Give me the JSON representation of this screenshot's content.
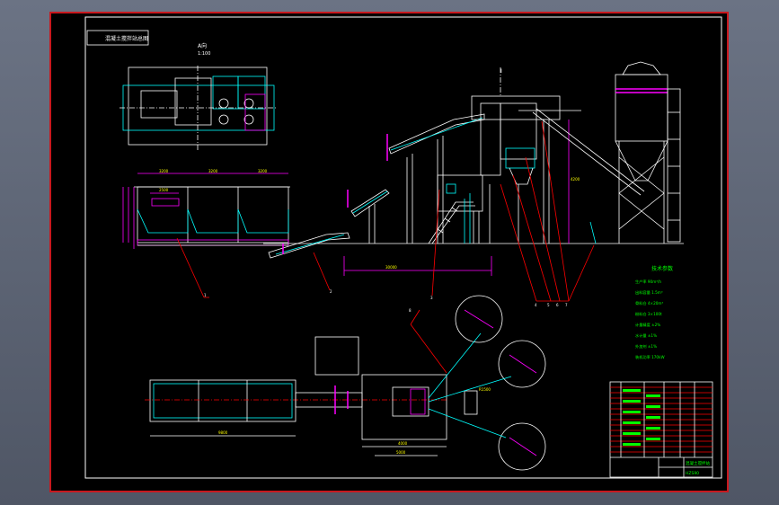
{
  "drawing": {
    "title_box_text": "混凝土搅拌站总图",
    "section_mark": "A向",
    "section_scale": "1:100",
    "top_mark": "I",
    "notes_title": "技术参数",
    "notes": [
      "生产率   90m³/h",
      "出料容量   1.5m³",
      "骨料仓   4×20m³",
      "粉料仓   3×100t",
      "计量精度  ±2%",
      "水计量   ±1%",
      "外加剂    ±1%",
      "装机功率   170kW"
    ],
    "dims": {
      "left_total": "5800",
      "left_parts": [
        "3200",
        "3200",
        "3200"
      ],
      "left_sub": "2500",
      "conveyor_span": "30000",
      "plant_height": "4200",
      "lower_dim_1": "9800",
      "lower_dim_2": "4000",
      "lower_dim_3": "5000",
      "silo_radius": "R1500"
    },
    "balloons": [
      "1",
      "2",
      "3",
      "4",
      "5",
      "6",
      "7",
      "8"
    ],
    "title_block": {
      "drawing_name": "混凝土搅拌站",
      "drawing_no": "HZS90",
      "rows": 14
    }
  }
}
